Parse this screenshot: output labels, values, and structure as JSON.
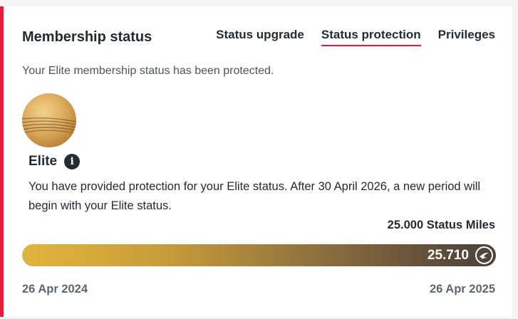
{
  "header": {
    "title": "Membership status",
    "tabs": [
      {
        "label": "Status upgrade",
        "active": false
      },
      {
        "label": "Status protection",
        "active": true
      },
      {
        "label": "Privileges",
        "active": false
      }
    ]
  },
  "protected_message": "Your Elite membership status has been protected.",
  "level": {
    "name": "Elite",
    "badge_icon": "elite-badge-icon",
    "info_icon": "info-icon"
  },
  "description": "You have provided protection for your Elite status. After 30 April 2026, a new period will begin with your Elite status.",
  "progress": {
    "target_label": "25.000 Status Miles",
    "current_value": "25.710",
    "fill_fraction": 1.0,
    "start_date": "26 Apr 2024",
    "end_date": "26 Apr 2025",
    "icon": "airline-logo-icon"
  },
  "colors": {
    "accent_red": "#e41d3b",
    "gold_start": "#e0b53c",
    "bar_end": "#4d4238"
  }
}
